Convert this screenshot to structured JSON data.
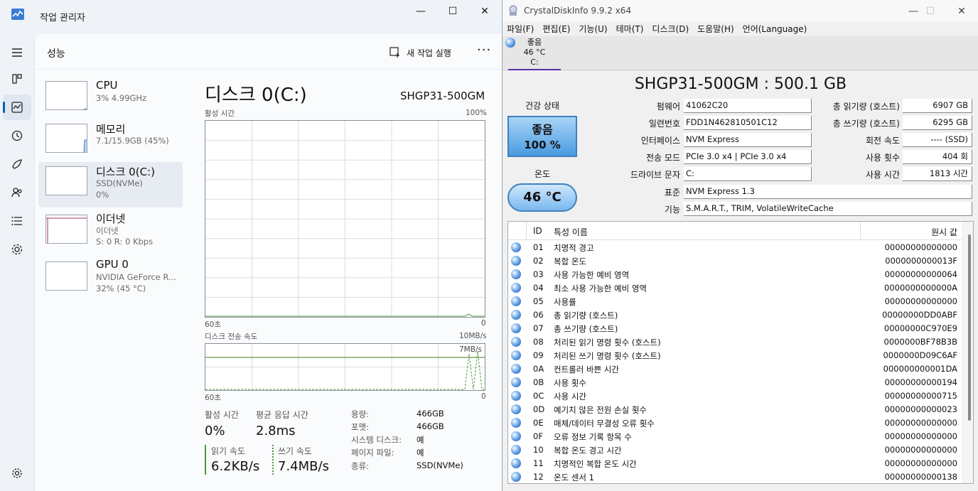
{
  "task_manager": {
    "title": "작업 관리자",
    "header_title": "성능",
    "new_task_label": "새 작업 실행",
    "more_label": "···",
    "devices": [
      {
        "name": "CPU",
        "sub1": "3% 4.99GHz",
        "sub2": ""
      },
      {
        "name": "메모리",
        "sub1": "7.1/15.9GB (45%)",
        "sub2": ""
      },
      {
        "name": "디스크 0(C:)",
        "sub1": "SSD(NVMe)",
        "sub2": "0%"
      },
      {
        "name": "이더넷",
        "sub1": "이더넷",
        "sub2": "S: 0 R: 0 Kbps"
      },
      {
        "name": "GPU 0",
        "sub1": "NVIDIA GeForce R...",
        "sub2": "32% (45 °C)"
      }
    ],
    "disk": {
      "title": "디스크 0(C:)",
      "model": "SHGP31-500GM",
      "active_time_label": "활성 시간",
      "active_time_max": "100%",
      "chart1_left": "60초",
      "chart1_right": "0",
      "transfer_label": "디스크 전송 속도",
      "transfer_max": "10MB/s",
      "transfer_marker": "7MB/s",
      "chart2_left": "60초",
      "chart2_right": "0",
      "stats": {
        "active_label": "활성 시간",
        "active_value": "0%",
        "response_label": "평균 응답 시간",
        "response_value": "2.8ms",
        "read_label": "읽기 속도",
        "read_value": "6.2KB/s",
        "write_label": "쓰기 속도",
        "write_value": "7.4MB/s"
      },
      "props": [
        {
          "label": "용량:",
          "value": "466GB"
        },
        {
          "label": "포맷:",
          "value": "466GB"
        },
        {
          "label": "시스템 디스크:",
          "value": "예"
        },
        {
          "label": "페이지 파일:",
          "value": "예"
        },
        {
          "label": "종류:",
          "value": "SSD(NVMe)"
        }
      ]
    }
  },
  "cdi": {
    "title": "CrystalDiskInfo 9.9.2 x64",
    "menu": [
      "파일(F)",
      "편집(E)",
      "기능(U)",
      "테마(T)",
      "디스크(D)",
      "도움말(H)",
      "언어(Language)"
    ],
    "tab": {
      "status": "좋음",
      "temp": "46 °C",
      "drive": "C:"
    },
    "heading": "SHGP31-500GM : 500.1 GB",
    "health_label": "건강 상태",
    "health_status": "좋음",
    "health_percent": "100 %",
    "temp_label": "온도",
    "temp_value": "46 °C",
    "fields_left": [
      {
        "label": "펌웨어",
        "value": "41062C20"
      },
      {
        "label": "일련번호",
        "value": "FDD1N462810501C12"
      },
      {
        "label": "인터페이스",
        "value": "NVM Express"
      },
      {
        "label": "전송 모드",
        "value": "PCIe 3.0 x4 | PCIe 3.0 x4"
      },
      {
        "label": "드라이브 문자",
        "value": "C:"
      }
    ],
    "fields_right": [
      {
        "label": "총 읽기량 (호스트)",
        "value": "6907 GB"
      },
      {
        "label": "총 쓰기량 (호스트)",
        "value": "6295 GB"
      },
      {
        "label": "회전 속도",
        "value": "---- (SSD)"
      },
      {
        "label": "사용 횟수",
        "value": "404 회"
      },
      {
        "label": "사용 시간",
        "value": "1813 시간"
      }
    ],
    "standard_label": "표준",
    "standard_value": "NVM Express 1.3",
    "features_label": "기능",
    "features_value": "S.M.A.R.T., TRIM, VolatileWriteCache",
    "table_headers": {
      "id": "ID",
      "name": "특성 이름",
      "raw": "원시 값"
    },
    "attributes": [
      {
        "id": "01",
        "name": "치명적 경고",
        "raw": "00000000000000"
      },
      {
        "id": "02",
        "name": "복합 온도",
        "raw": "0000000000013F"
      },
      {
        "id": "03",
        "name": "사용 가능한 예비 영역",
        "raw": "00000000000064"
      },
      {
        "id": "04",
        "name": "최소 사용 가능한 예비 영역",
        "raw": "0000000000000A"
      },
      {
        "id": "05",
        "name": "사용률",
        "raw": "00000000000000"
      },
      {
        "id": "06",
        "name": "총 읽기량 (호스트)",
        "raw": "00000000DD0ABF"
      },
      {
        "id": "07",
        "name": "총 쓰기량 (호스트)",
        "raw": "00000000C970E9"
      },
      {
        "id": "08",
        "name": "처리된 읽기 명령 횟수 (호스트)",
        "raw": "0000000BF78B3B"
      },
      {
        "id": "09",
        "name": "처리된 쓰기 명령 횟수 (호스트)",
        "raw": "0000000D09C6AF"
      },
      {
        "id": "0A",
        "name": "컨트롤러 바쁜 시간",
        "raw": "000000000001DA"
      },
      {
        "id": "0B",
        "name": "사용 횟수",
        "raw": "00000000000194"
      },
      {
        "id": "0C",
        "name": "사용 시간",
        "raw": "00000000000715"
      },
      {
        "id": "0D",
        "name": "예기치 않은 전원 손실 횟수",
        "raw": "00000000000023"
      },
      {
        "id": "0E",
        "name": "매체/데이터 무결성 오류 횟수",
        "raw": "00000000000000"
      },
      {
        "id": "0F",
        "name": "오류 정보 기록 항목 수",
        "raw": "00000000000000"
      },
      {
        "id": "10",
        "name": "복합 온도 경고 시간",
        "raw": "00000000000000"
      },
      {
        "id": "11",
        "name": "치명적인 복합 온도 시간",
        "raw": "00000000000000"
      },
      {
        "id": "12",
        "name": "온도 센서 1",
        "raw": "00000000000138"
      }
    ]
  }
}
